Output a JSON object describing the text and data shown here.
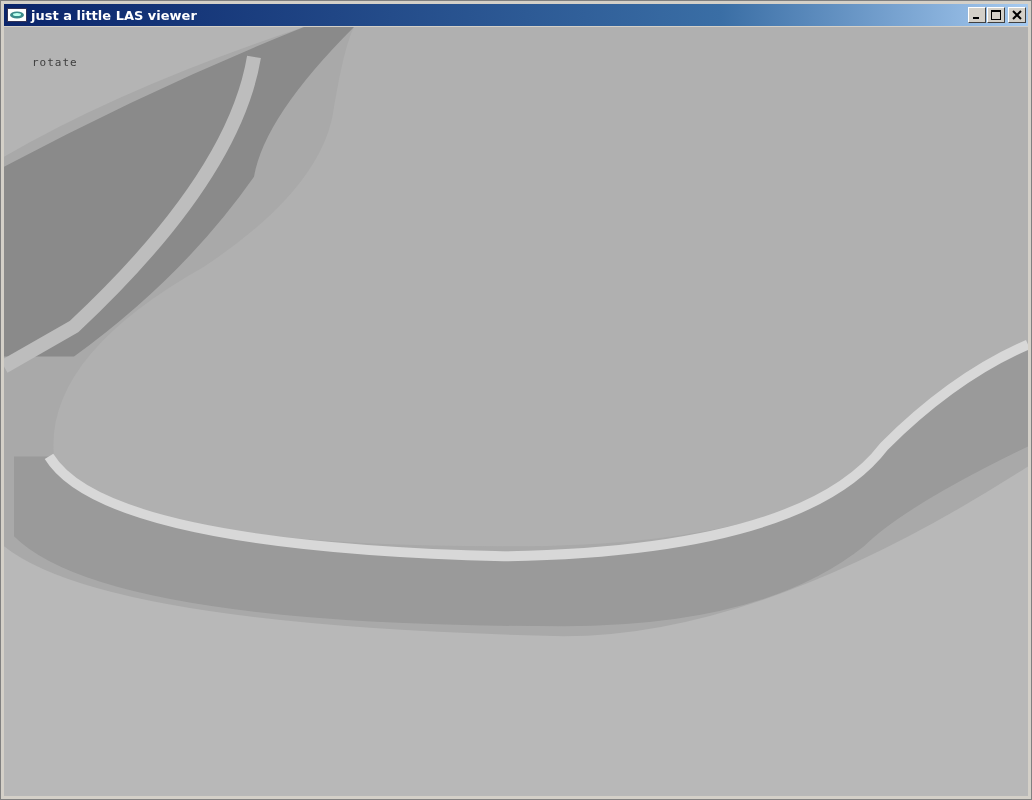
{
  "window": {
    "title": "just a little LAS viewer"
  },
  "viewport": {
    "mode_label": "rotate"
  }
}
